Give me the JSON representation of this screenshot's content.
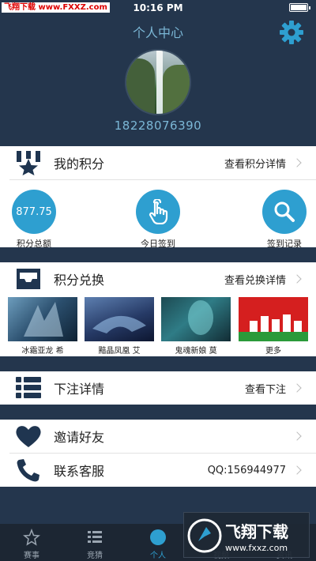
{
  "status_bar": {
    "watermark": "飞翔下载 www.FXXZ.com",
    "time": "10:16 PM"
  },
  "header": {
    "title": "个人中心",
    "phone": "18228076390"
  },
  "points": {
    "label": "我的积分",
    "detail": "查看积分详情",
    "total_value": "877.75",
    "total_label": "积分总额",
    "checkin_label": "今日签到",
    "records_label": "签到记录"
  },
  "exchange": {
    "label": "积分兑换",
    "detail": "查看兑换详情",
    "items": [
      {
        "label": "冰霜亚龙 希"
      },
      {
        "label": "黯晶凤凰 艾"
      },
      {
        "label": "鬼魂新娘 莫"
      },
      {
        "label": "更多"
      }
    ]
  },
  "bets": {
    "label": "下注详情",
    "detail": "查看下注"
  },
  "invite": {
    "label": "邀请好友"
  },
  "service": {
    "label": "联系客服",
    "detail": "QQ:156944977"
  },
  "tabbar": {
    "tabs": [
      {
        "label": "赛事"
      },
      {
        "label": "竞猜"
      },
      {
        "label": "个人"
      },
      {
        "label": "视频"
      },
      {
        "label": "资讯"
      }
    ],
    "active_index": 2
  },
  "watermark_bottom": {
    "title": "飞翔下载",
    "url": "www.fxxz.com"
  },
  "colors": {
    "header_bg": "#24364d",
    "accent": "#2e9fd0",
    "title_text": "#7bb7d6",
    "icon_navy": "#1f3550"
  }
}
